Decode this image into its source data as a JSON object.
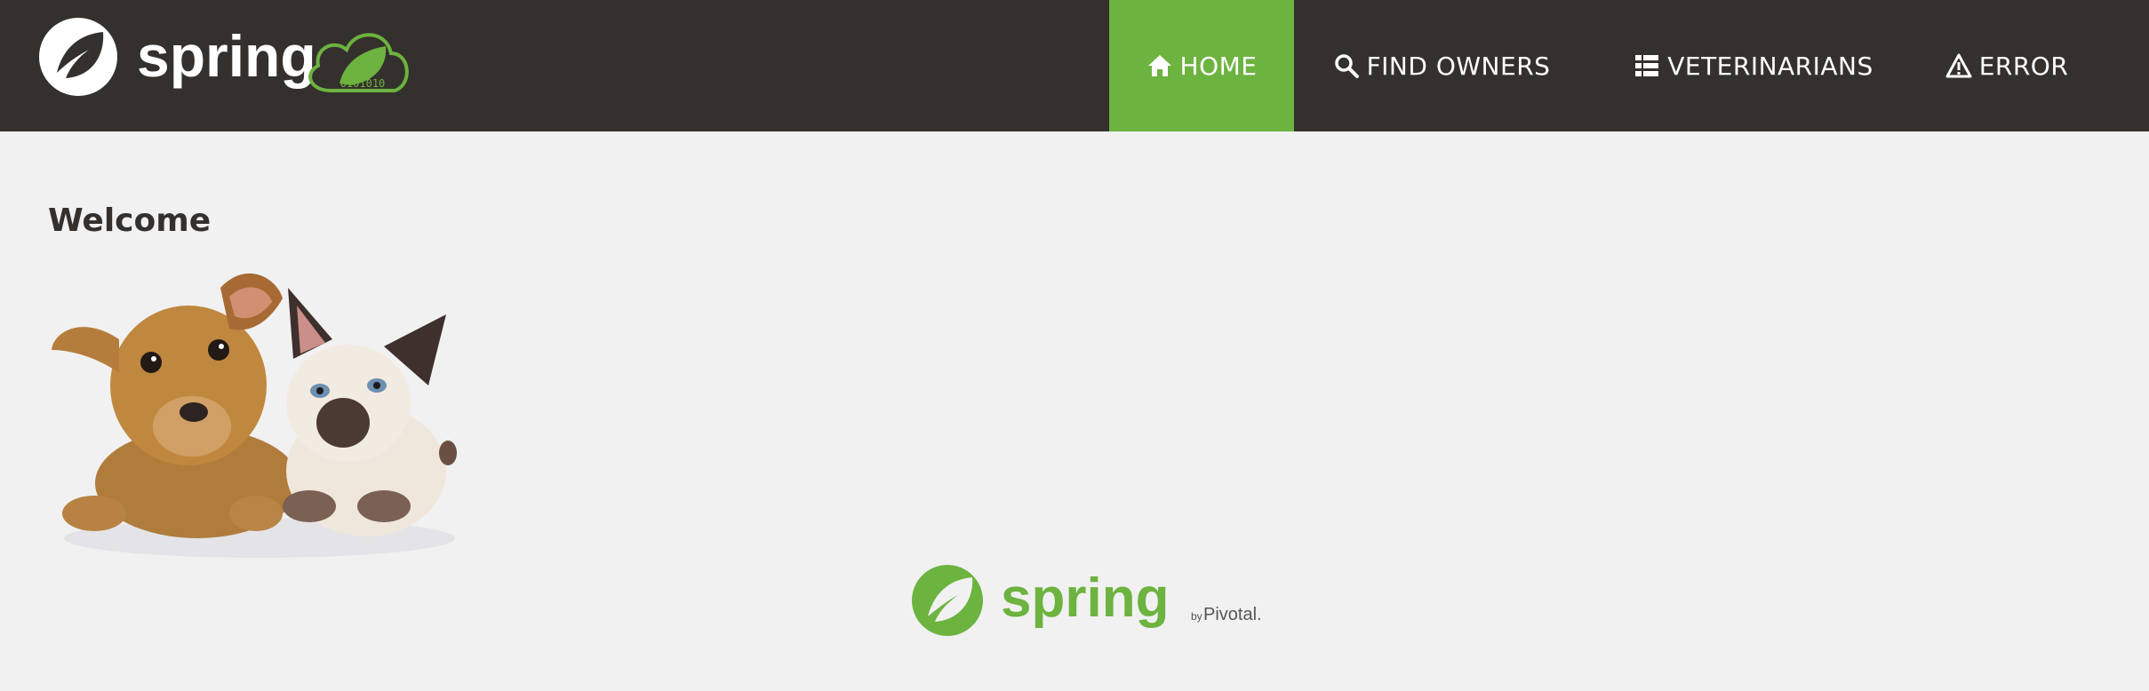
{
  "brand": {
    "name": "spring",
    "badge_digits": "0101010"
  },
  "nav": {
    "items": [
      {
        "label": "HOME",
        "icon": "home-icon",
        "active": true
      },
      {
        "label": "FIND OWNERS",
        "icon": "search-icon",
        "active": false
      },
      {
        "label": "VETERINARIANS",
        "icon": "list-icon",
        "active": false
      },
      {
        "label": "ERROR",
        "icon": "warning-icon",
        "active": false
      }
    ]
  },
  "main": {
    "heading": "Welcome",
    "image_alt": "pets"
  },
  "footer": {
    "logo_text": "spring",
    "by_text": "by",
    "vendor_text": "Pivotal."
  },
  "colors": {
    "navbar_bg": "#34302d",
    "accent_green": "#6db33f",
    "page_bg": "#f1f1f1"
  }
}
